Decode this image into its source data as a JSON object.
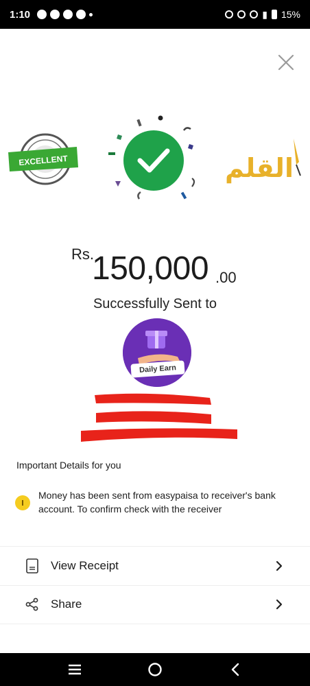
{
  "status_bar": {
    "time": "1:10",
    "battery": "15%"
  },
  "badge": {
    "text": "EXCELLENT"
  },
  "logo": {
    "text": "القلم"
  },
  "amount": {
    "currency": "Rs.",
    "main": "150,000",
    "decimal": ".00"
  },
  "sent_to_label": "Successfully Sent to",
  "recipient": {
    "avatar_label": "Daily Earn"
  },
  "details": {
    "heading": "Important Details for you",
    "message": "Money has been sent from easypaisa to receiver's bank account. To confirm check with the receiver"
  },
  "actions": [
    {
      "label": "View Receipt",
      "icon": "receipt-icon"
    },
    {
      "label": "Share",
      "icon": "share-icon"
    }
  ],
  "colors": {
    "success": "#1fa24a",
    "info": "#f5cc1f",
    "avatar_bg": "#6a2fb5",
    "redaction": "#e8231a"
  }
}
